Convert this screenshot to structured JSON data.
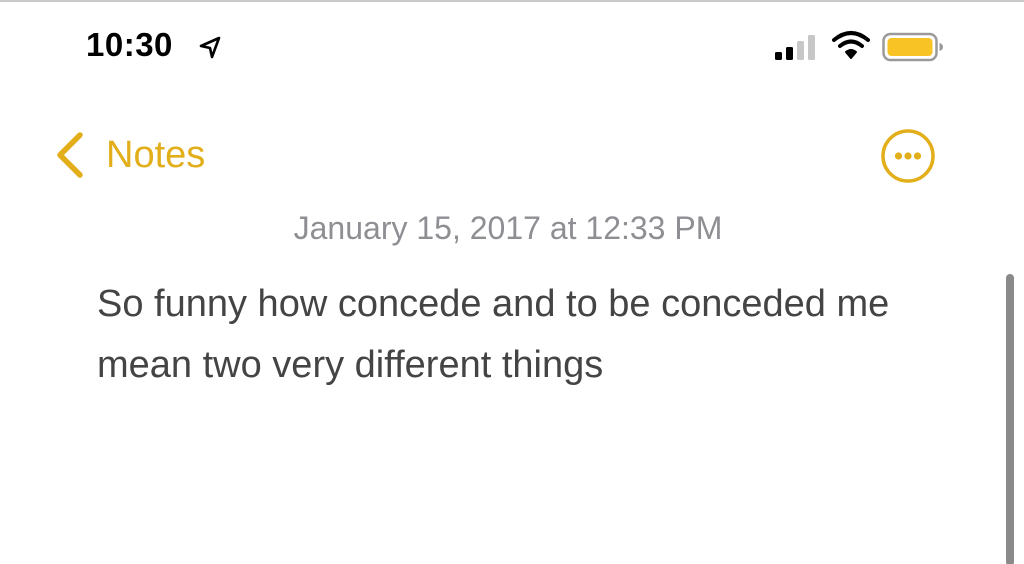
{
  "status_bar": {
    "time": "10:30",
    "location_icon": "location-arrow-icon",
    "signal_icon": "cellular-signal-icon",
    "signal_bars_active": 2,
    "signal_bars_total": 4,
    "wifi_icon": "wifi-icon",
    "battery_icon": "battery-icon",
    "battery_color": "#f7c325"
  },
  "nav": {
    "back_label": "Notes",
    "back_icon": "chevron-left-icon",
    "more_icon": "ellipsis-circle-icon",
    "accent_color": "#e2ae1a"
  },
  "note": {
    "date": "January 15, 2017 at 12:33 PM",
    "body": "So funny how concede and to be conceded me mean two very different things"
  }
}
